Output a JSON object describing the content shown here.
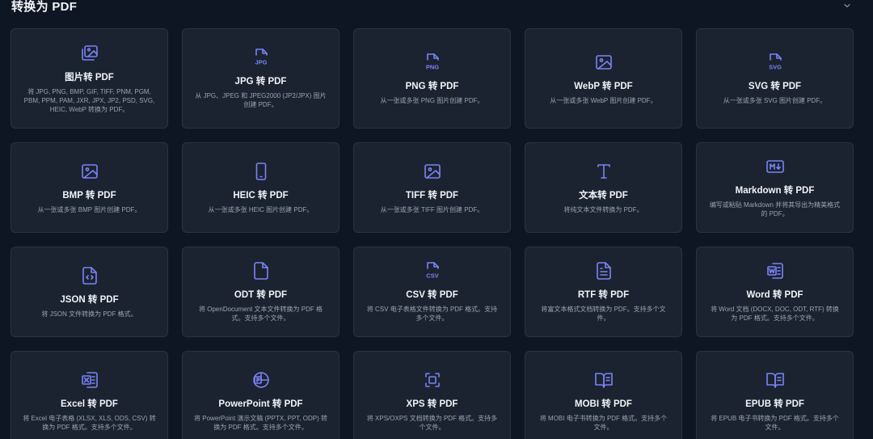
{
  "section": {
    "title": "转换为 PDF"
  },
  "colors": {
    "accent": "#7b83f5",
    "background": "#0f1623",
    "card": "#1b2330"
  },
  "cards": [
    {
      "icon": "images-icon",
      "title": "图片转 PDF",
      "desc": "将 JPG, PNG, BMP, GIF, TIFF, PNM, PGM, PBM, PPM, PAM, JXR, JPX, JP2, PSD, SVG, HEIC, WebP 转换为 PDF。"
    },
    {
      "icon": "jpg-file-icon",
      "title": "JPG 转 PDF",
      "desc": "从 JPG、JPEG 和 JPEG2000 (JP2/JPX) 图片创建 PDF。"
    },
    {
      "icon": "png-file-icon",
      "title": "PNG 转 PDF",
      "desc": "从一张或多张 PNG 图片创建 PDF。"
    },
    {
      "icon": "image-icon",
      "title": "WebP 转 PDF",
      "desc": "从一张或多张 WebP 图片创建 PDF。"
    },
    {
      "icon": "svg-file-icon",
      "title": "SVG 转 PDF",
      "desc": "从一张或多张 SVG 图片创建 PDF。"
    },
    {
      "icon": "image-icon",
      "title": "BMP 转 PDF",
      "desc": "从一张或多张 BMP 图片创建 PDF。"
    },
    {
      "icon": "smartphone-icon",
      "title": "HEIC 转 PDF",
      "desc": "从一张或多张 HEIC 图片创建 PDF。"
    },
    {
      "icon": "image-icon",
      "title": "TIFF 转 PDF",
      "desc": "从一张或多张 TIFF 图片创建 PDF。"
    },
    {
      "icon": "text-type-icon",
      "title": "文本转 PDF",
      "desc": "将纯文本文件转换为 PDF。"
    },
    {
      "icon": "markdown-icon",
      "title": "Markdown 转 PDF",
      "desc": "编写或粘贴 Markdown 并将其导出为精美格式的 PDF。"
    },
    {
      "icon": "code-file-icon",
      "title": "JSON 转 PDF",
      "desc": "将 JSON 文件转换为 PDF 格式。"
    },
    {
      "icon": "document-icon",
      "title": "ODT 转 PDF",
      "desc": "将 OpenDocument 文本文件转换为 PDF 格式。支持多个文件。"
    },
    {
      "icon": "csv-file-icon",
      "title": "CSV 转 PDF",
      "desc": "将 CSV 电子表格文件转换为 PDF 格式。支持多个文件。"
    },
    {
      "icon": "text-file-icon",
      "title": "RTF 转 PDF",
      "desc": "将富文本格式文档转换为 PDF。支持多个文件。"
    },
    {
      "icon": "word-file-icon",
      "title": "Word 转 PDF",
      "desc": "将 Word 文档 (DOCX, DOC, ODT, RTF) 转换为 PDF 格式。支持多个文件。"
    },
    {
      "icon": "excel-file-icon",
      "title": "Excel 转 PDF",
      "desc": "将 Excel 电子表格 (XLSX, XLS, ODS, CSV) 转换为 PDF 格式。支持多个文件。"
    },
    {
      "icon": "powerpoint-icon",
      "title": "PowerPoint 转 PDF",
      "desc": "将 PowerPoint 演示文稿 (PPTX, PPT, ODP) 转换为 PDF 格式。支持多个文件。"
    },
    {
      "icon": "scan-icon",
      "title": "XPS 转 PDF",
      "desc": "将 XPS/OXPS 文档转换为 PDF 格式。支持多个文件。"
    },
    {
      "icon": "book-open-icon",
      "title": "MOBI 转 PDF",
      "desc": "将 MOBI 电子书转换为 PDF 格式。支持多个文件。"
    },
    {
      "icon": "book-open-icon",
      "title": "EPUB 转 PDF",
      "desc": "将 EPUB 电子书转换为 PDF 格式。支持多个文件。"
    }
  ]
}
